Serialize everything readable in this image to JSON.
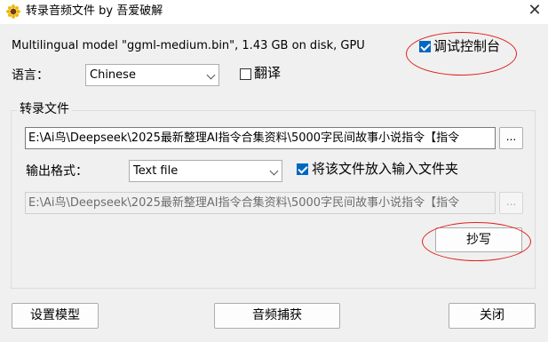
{
  "window": {
    "title": "转录音频文件 by 吾爱破解",
    "close_glyph": "✕"
  },
  "model_info": "Multilingual model \"ggml-medium.bin\", 1.43 GB on disk, GPU",
  "debug_console": {
    "label": "调试控制台",
    "checked": true
  },
  "language": {
    "label": "语言：",
    "selected": "Chinese"
  },
  "translate": {
    "label": "翻译",
    "checked": false
  },
  "transcribe_group": {
    "title": "转录文件",
    "input_path": "E:\\Ai鸟\\Deepseek\\2025最新整理AI指令合集资料\\5000字民间故事小说指令【指令",
    "browse_label": "...",
    "output_format_label": "输出格式：",
    "output_format_selected": "Text file",
    "place_in_input_folder": {
      "label": "将该文件放入输入文件夹",
      "checked": true
    },
    "output_path": "E:\\Ai鸟\\Deepseek\\2025最新整理AI指令合集资料\\5000字民间故事小说指令【指令",
    "output_browse_label": "...",
    "transcribe_button": "抄写"
  },
  "bottom": {
    "setup_model": "设置模型",
    "audio_capture": "音频捕获",
    "close": "关闭"
  },
  "colors": {
    "accent": "#0067c0",
    "annotation_red": "#e0201a",
    "background": "#f0f0f0"
  },
  "icons": {
    "app": "sunflower-icon",
    "close": "close-icon"
  }
}
